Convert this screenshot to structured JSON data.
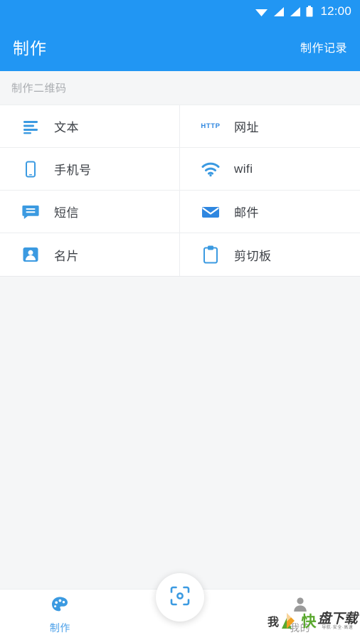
{
  "status_bar": {
    "time": "12:00",
    "icons": [
      "wifi-icon",
      "signal-icon",
      "signal-icon",
      "battery-icon"
    ]
  },
  "app_bar": {
    "title": "制作",
    "action_label": "制作记录"
  },
  "section": {
    "header": "制作二维码"
  },
  "grid": {
    "items": [
      {
        "icon": "text-lines-icon",
        "label": "文本",
        "column": "left"
      },
      {
        "icon": "http-icon",
        "label": "网址",
        "column": "right"
      },
      {
        "icon": "phone-icon",
        "label": "手机号",
        "column": "left"
      },
      {
        "icon": "wifi-icon",
        "label": "wifi",
        "column": "right"
      },
      {
        "icon": "message-icon",
        "label": "短信",
        "column": "left"
      },
      {
        "icon": "envelope-icon",
        "label": "邮件",
        "column": "right"
      },
      {
        "icon": "contact-card-icon",
        "label": "名片",
        "column": "left"
      },
      {
        "icon": "clipboard-icon",
        "label": "剪切板",
        "column": "right"
      }
    ],
    "http_badge_text": "HTTP"
  },
  "bottom_nav": {
    "items": [
      {
        "icon": "palette-icon",
        "label": "制作",
        "active": true
      },
      {
        "icon": "person-icon",
        "label": "我的",
        "active": false
      }
    ],
    "fab_icon": "scan-qr-icon"
  },
  "watermark": {
    "char": "我",
    "kuai": "快",
    "text": "盘下载",
    "subtitle": "导航·安全·高速"
  },
  "colors": {
    "primary": "#2196f3",
    "icon_blue": "#3b9ae1",
    "accent_active": "#4a9fe8",
    "background": "#f5f6f7",
    "surface": "#ffffff",
    "text_primary": "#3b3f45",
    "text_muted": "#a9acb0"
  }
}
